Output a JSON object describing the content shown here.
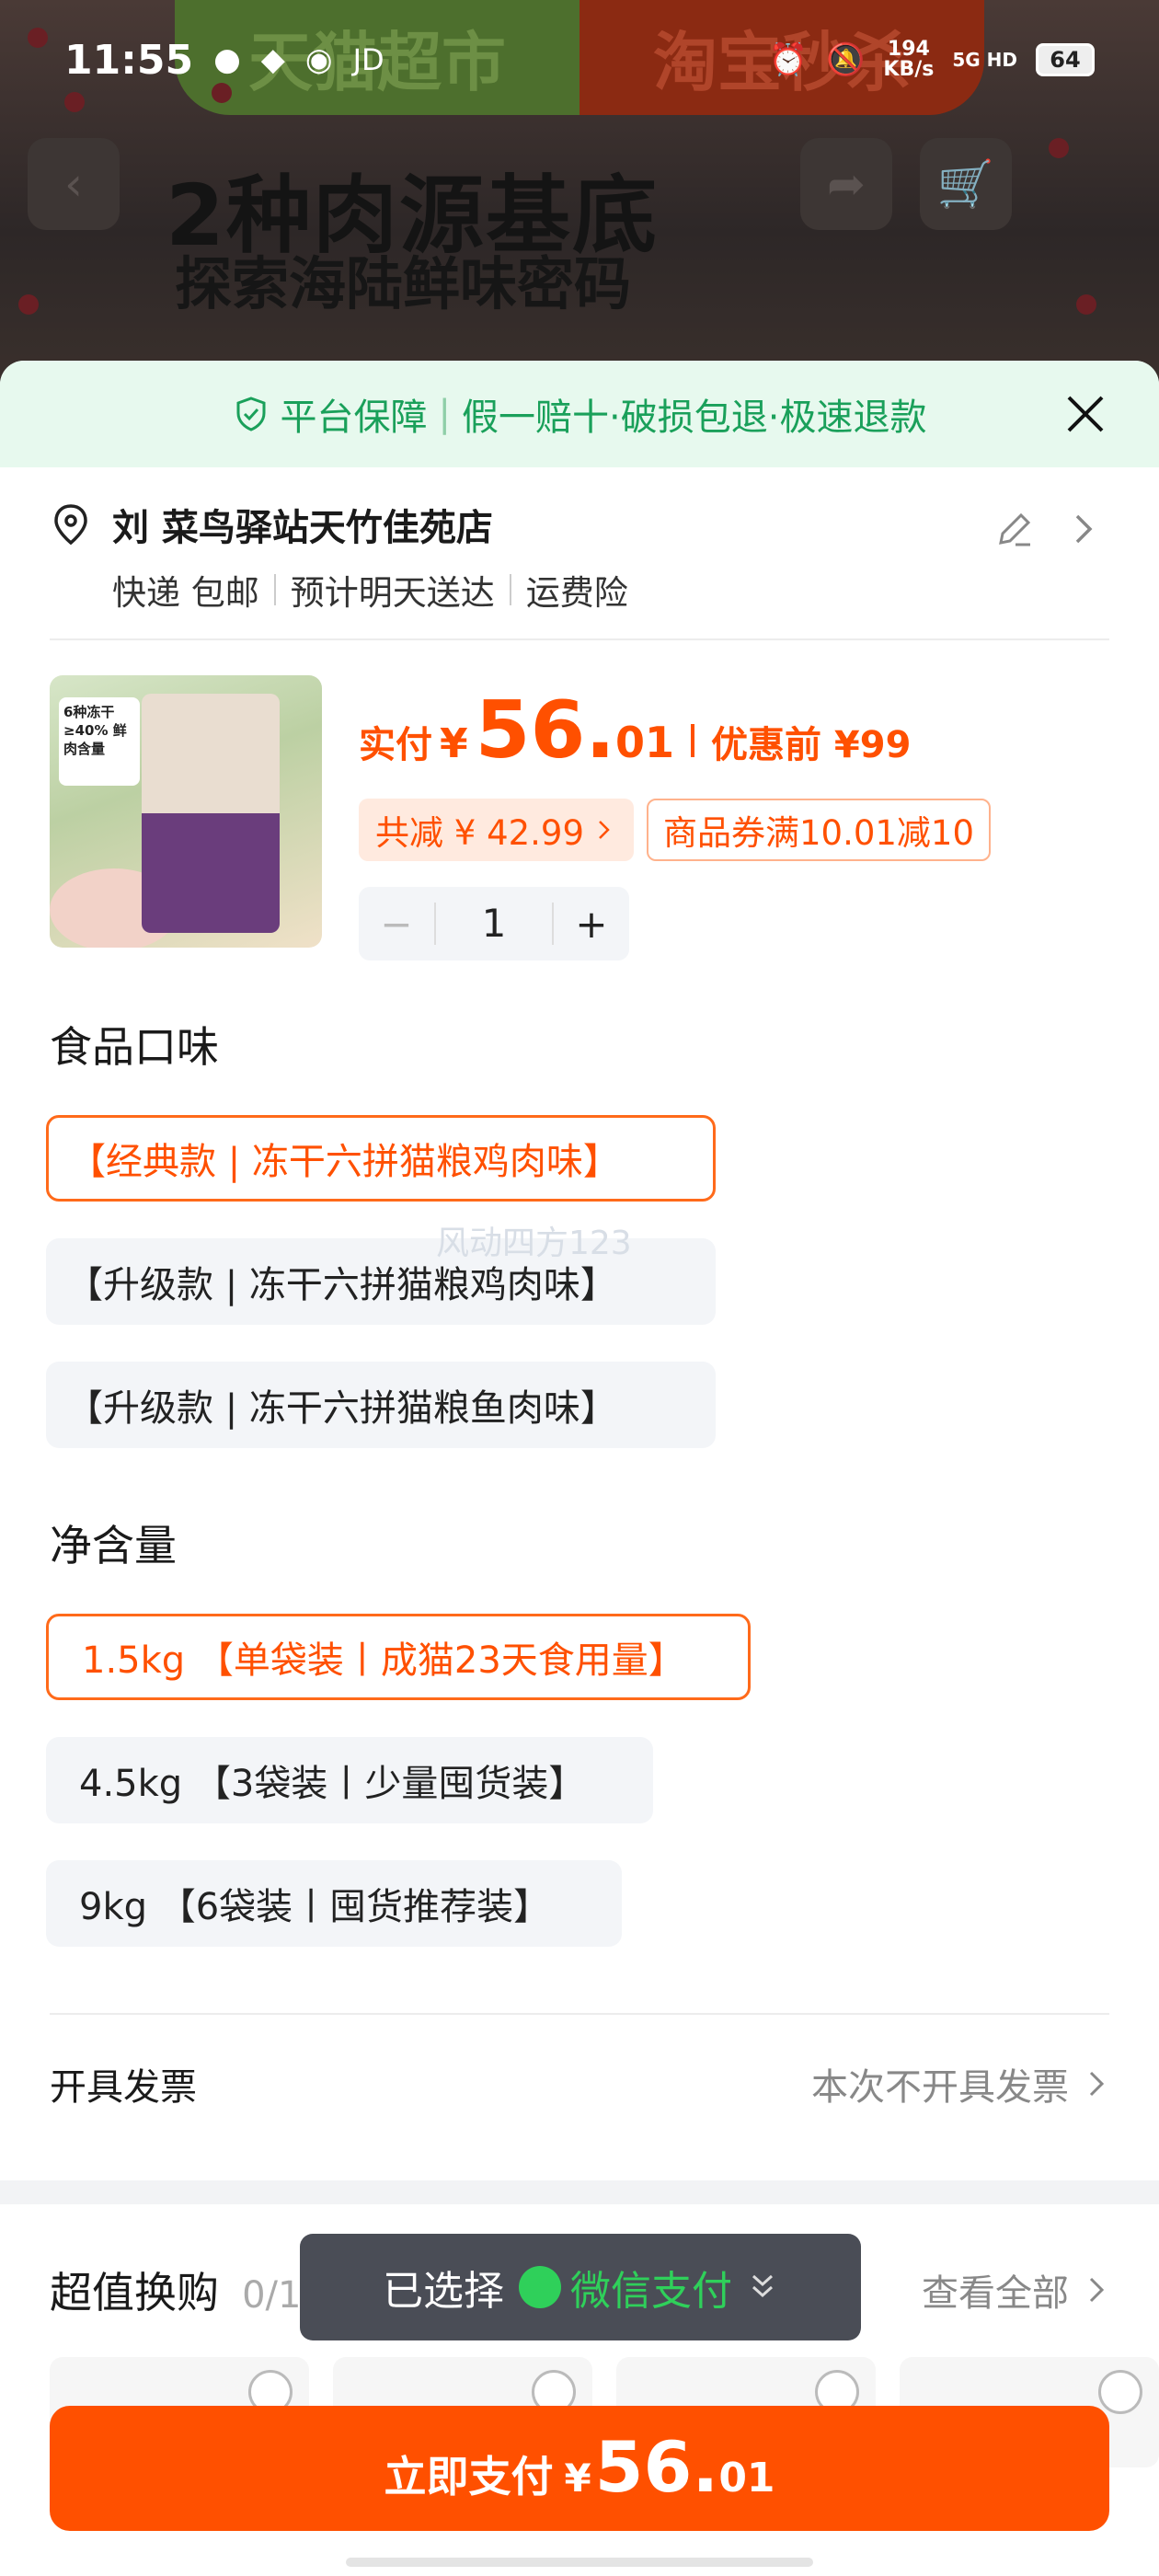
{
  "status_bar": {
    "time": "11:55",
    "left_icons": [
      "wechat-icon",
      "app-icon",
      "tmall-icon",
      "jd-label"
    ],
    "jd": "JD",
    "speed_value": "194",
    "speed_unit": "KB/s",
    "network": "5G HD",
    "battery": "64"
  },
  "background": {
    "banner_left": "天猫超市",
    "banner_right": "淘宝秒杀",
    "title": "2种肉源基底",
    "subtitle": "探索海陆鲜味密码"
  },
  "guarantee": {
    "label": "平台保障",
    "text": "假一赔十·破损包退·极速退款"
  },
  "address": {
    "name_line": "刘 菜鸟驿站天竹佳苑店",
    "shipping": "快递 包邮",
    "eta": "预计明天送达",
    "insurance": "运费险"
  },
  "product": {
    "image_tag": "6种冻干 ≥40% 鲜肉含量",
    "paid_label": "实付",
    "currency": "¥",
    "price_int": "56.",
    "price_dec": "01",
    "before_label": "优惠前 ¥99",
    "discount_chip": "共减 ¥ 42.99",
    "coupon_chip": "商品券满10.01减10",
    "qty_minus": "−",
    "quantity": "1",
    "qty_plus": "+"
  },
  "taste": {
    "title": "食品口味",
    "options": [
      "【经典款 | 冻干六拼猫粮鸡肉味】",
      "【升级款 | 冻干六拼猫粮鸡肉味】",
      "【升级款 | 冻干六拼猫粮鱼肉味】"
    ],
    "selected_index": 0
  },
  "watermark": "风动四方123",
  "weight": {
    "title": "净含量",
    "options": [
      "1.5kg 【单袋装丨成猫23天食用量】",
      "4.5kg 【3袋装丨少量囤货装】",
      "9kg 【6袋装丨囤货推荐装】"
    ],
    "selected_index": 0
  },
  "invoice": {
    "label": "开具发票",
    "value": "本次不开具发票"
  },
  "swap": {
    "title": "超值换购",
    "count": "0/10",
    "view_all": "查看全部"
  },
  "payment_toast": {
    "selected_label": "已选择",
    "method": "微信支付"
  },
  "pay_button": {
    "label": "立即支付",
    "currency": "¥",
    "amount_int": "56.",
    "amount_dec": "01"
  },
  "colors": {
    "accent": "#ff5000",
    "guarantee_green": "#1aa05a",
    "wechat_green": "#2fd05a"
  }
}
